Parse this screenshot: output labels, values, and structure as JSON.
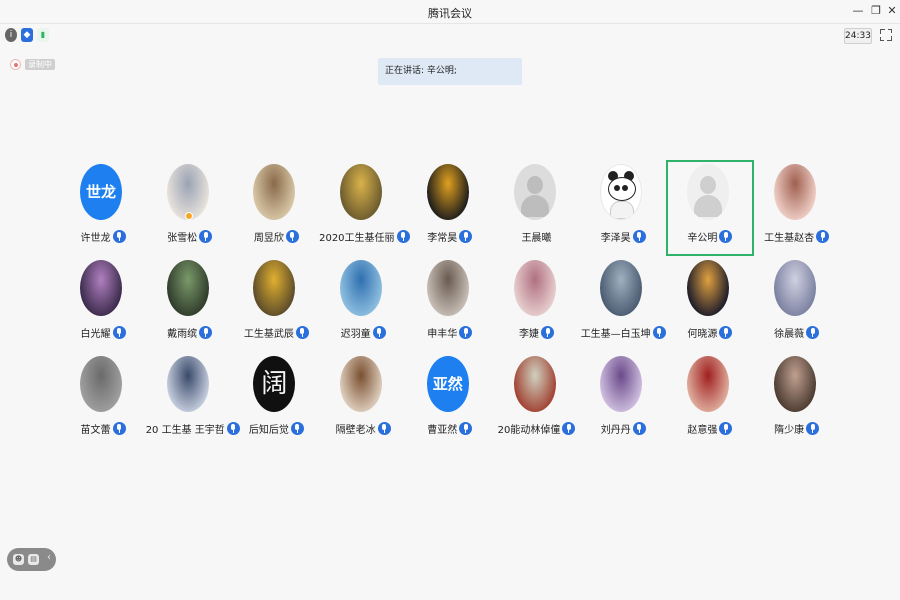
{
  "window": {
    "title": "腾讯会议"
  },
  "toolbar": {
    "timer": "24:33",
    "icons": [
      "info-icon",
      "shield-icon",
      "signal-icon"
    ]
  },
  "recording": {
    "label": "录制中"
  },
  "speaking": {
    "text": "正在讲话: 辛公明;"
  },
  "colors": {
    "accent": "#1d7ff0",
    "active_border": "#2fb36a",
    "mic": "#2a6fdb",
    "speaking_bg": "#dfe9f6"
  },
  "participants": [
    {
      "name": "许世龙",
      "avatar_text": "世龙",
      "mic": "mic-icon"
    },
    {
      "name": "张雪松",
      "avatar": "photo",
      "mic": "mic-icon"
    },
    {
      "name": "周昱欣",
      "avatar": "photo",
      "mic": "mic-icon"
    },
    {
      "name": "2020工生基任丽",
      "avatar": "photo",
      "mic": "mic-icon"
    },
    {
      "name": "李常昊",
      "avatar": "photo",
      "mic": "mic-icon"
    },
    {
      "name": "王晨曦",
      "avatar": "default",
      "mic": ""
    },
    {
      "name": "李泽昊",
      "avatar": "panda",
      "mic": "mic-icon"
    },
    {
      "name": "辛公明",
      "avatar": "default",
      "mic": "mic-icon",
      "active": true
    },
    {
      "name": "工生基赵杏",
      "avatar": "photo",
      "mic": "mic-icon"
    },
    {
      "name": "白光耀",
      "avatar": "photo",
      "mic": "mic-icon"
    },
    {
      "name": "戴雨缤",
      "avatar": "photo",
      "mic": "mic-icon"
    },
    {
      "name": "工生基武辰",
      "avatar": "photo",
      "mic": "mic-icon"
    },
    {
      "name": "迟羽童",
      "avatar": "photo",
      "mic": "mic-icon"
    },
    {
      "name": "申丰华",
      "avatar": "photo",
      "mic": "mic-icon"
    },
    {
      "name": "李婕",
      "avatar": "photo",
      "mic": "mic-icon"
    },
    {
      "name": "工生基—白玉坤",
      "avatar": "photo",
      "mic": "mic-icon"
    },
    {
      "name": "何晓源",
      "avatar": "photo",
      "mic": "mic-icon"
    },
    {
      "name": "徐晨薇",
      "avatar": "photo",
      "mic": "mic-icon"
    },
    {
      "name": "苗文蕾",
      "avatar": "photo",
      "mic": "mic-icon"
    },
    {
      "name": "20 工生基 王宇哲",
      "avatar": "photo",
      "mic": "mic-icon"
    },
    {
      "name": "后知后觉",
      "avatar": "photo",
      "mic": "mic-icon"
    },
    {
      "name": "隔壁老冰",
      "avatar": "photo",
      "mic": "mic-icon"
    },
    {
      "name": "曹亚然",
      "avatar_text": "亚然",
      "mic": "mic-icon"
    },
    {
      "name": "20能动林倬僮",
      "avatar": "photo",
      "mic": "mic-icon"
    },
    {
      "name": "刘丹丹",
      "avatar": "photo",
      "mic": "mic-icon"
    },
    {
      "name": "赵意强",
      "avatar": "photo",
      "mic": "mic-icon"
    },
    {
      "name": "隋少康",
      "avatar": "photo",
      "mic": "mic-icon"
    }
  ],
  "avatar_glyphs": {
    "后知后觉": "阔"
  },
  "bottom_bar": {
    "icons": [
      "emoji-icon",
      "chat-icon"
    ],
    "collapse": "‹"
  }
}
